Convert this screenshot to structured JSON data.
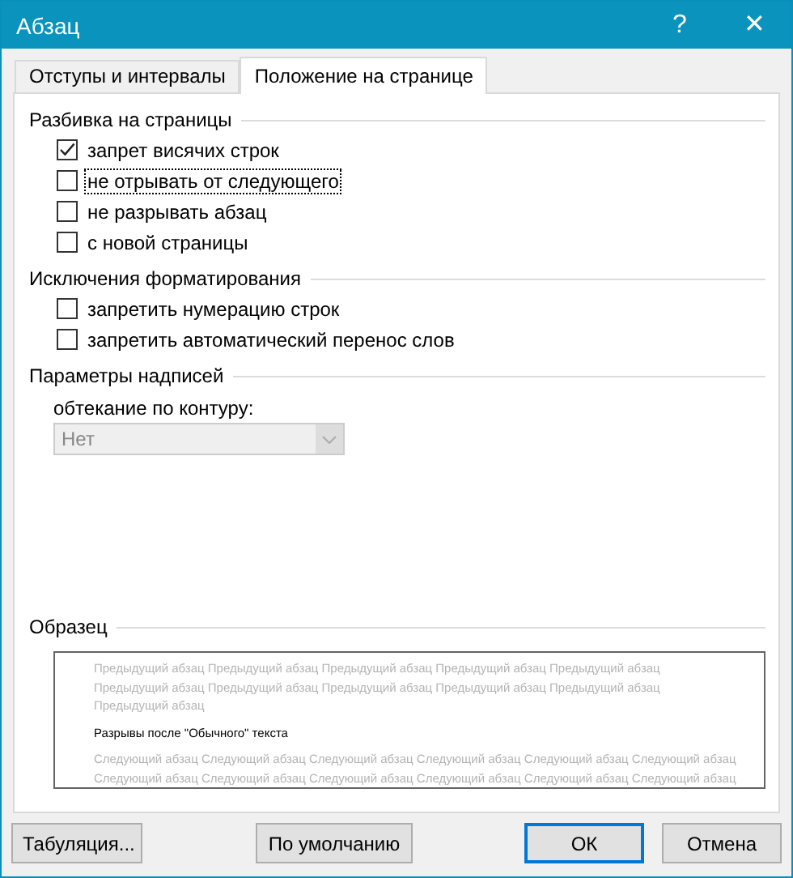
{
  "window": {
    "title": "Абзац",
    "help": "?",
    "close": "✕"
  },
  "tabs": [
    {
      "label": "Отступы и интервалы",
      "selected": false
    },
    {
      "label": "Положение на странице",
      "selected": true
    }
  ],
  "sections": [
    {
      "title": "Разбивка на страницы",
      "checkboxes": [
        {
          "label": "запрет висячих строк",
          "checked": true,
          "focused": false
        },
        {
          "label": "не отрывать от следующего",
          "checked": false,
          "focused": true
        },
        {
          "label": "не разрывать абзац",
          "checked": false,
          "focused": false
        },
        {
          "label": "с новой страницы",
          "checked": false,
          "focused": false
        }
      ]
    },
    {
      "title": "Исключения форматирования",
      "checkboxes": [
        {
          "label": "запретить нумерацию строк",
          "checked": false,
          "focused": false
        },
        {
          "label": "запретить автоматический перенос слов",
          "checked": false,
          "focused": false
        }
      ]
    },
    {
      "title": "Параметры надписей",
      "combo": {
        "label": "обтекание по контуру:",
        "value": "Нет",
        "disabled": true
      }
    }
  ],
  "preview": {
    "title": "Образец",
    "lines": [
      {
        "kind": "faded",
        "text": "Предыдущий абзац Предыдущий абзац Предыдущий абзац Предыдущий абзац Предыдущий абзац"
      },
      {
        "kind": "faded",
        "text": "Предыдущий абзац Предыдущий абзац Предыдущий абзац Предыдущий абзац Предыдущий абзац"
      },
      {
        "kind": "faded",
        "text": "Предыдущий абзац"
      },
      {
        "kind": "current",
        "text": "Разрывы после \"Обычного\" текста"
      },
      {
        "kind": "faded",
        "text": "Следующий абзац Следующий абзац Следующий абзац Следующий абзац Следующий абзац Следующий абзац"
      },
      {
        "kind": "faded",
        "text": "Следующий абзац Следующий абзац Следующий абзац Следующий абзац Следующий абзац Следующий абзац"
      }
    ]
  },
  "buttons": [
    {
      "label": "Табуляция...",
      "default": false
    },
    {
      "label": "По умолчанию",
      "default": false
    },
    {
      "label": "ОК",
      "default": true
    },
    {
      "label": "Отмена",
      "default": false
    }
  ]
}
